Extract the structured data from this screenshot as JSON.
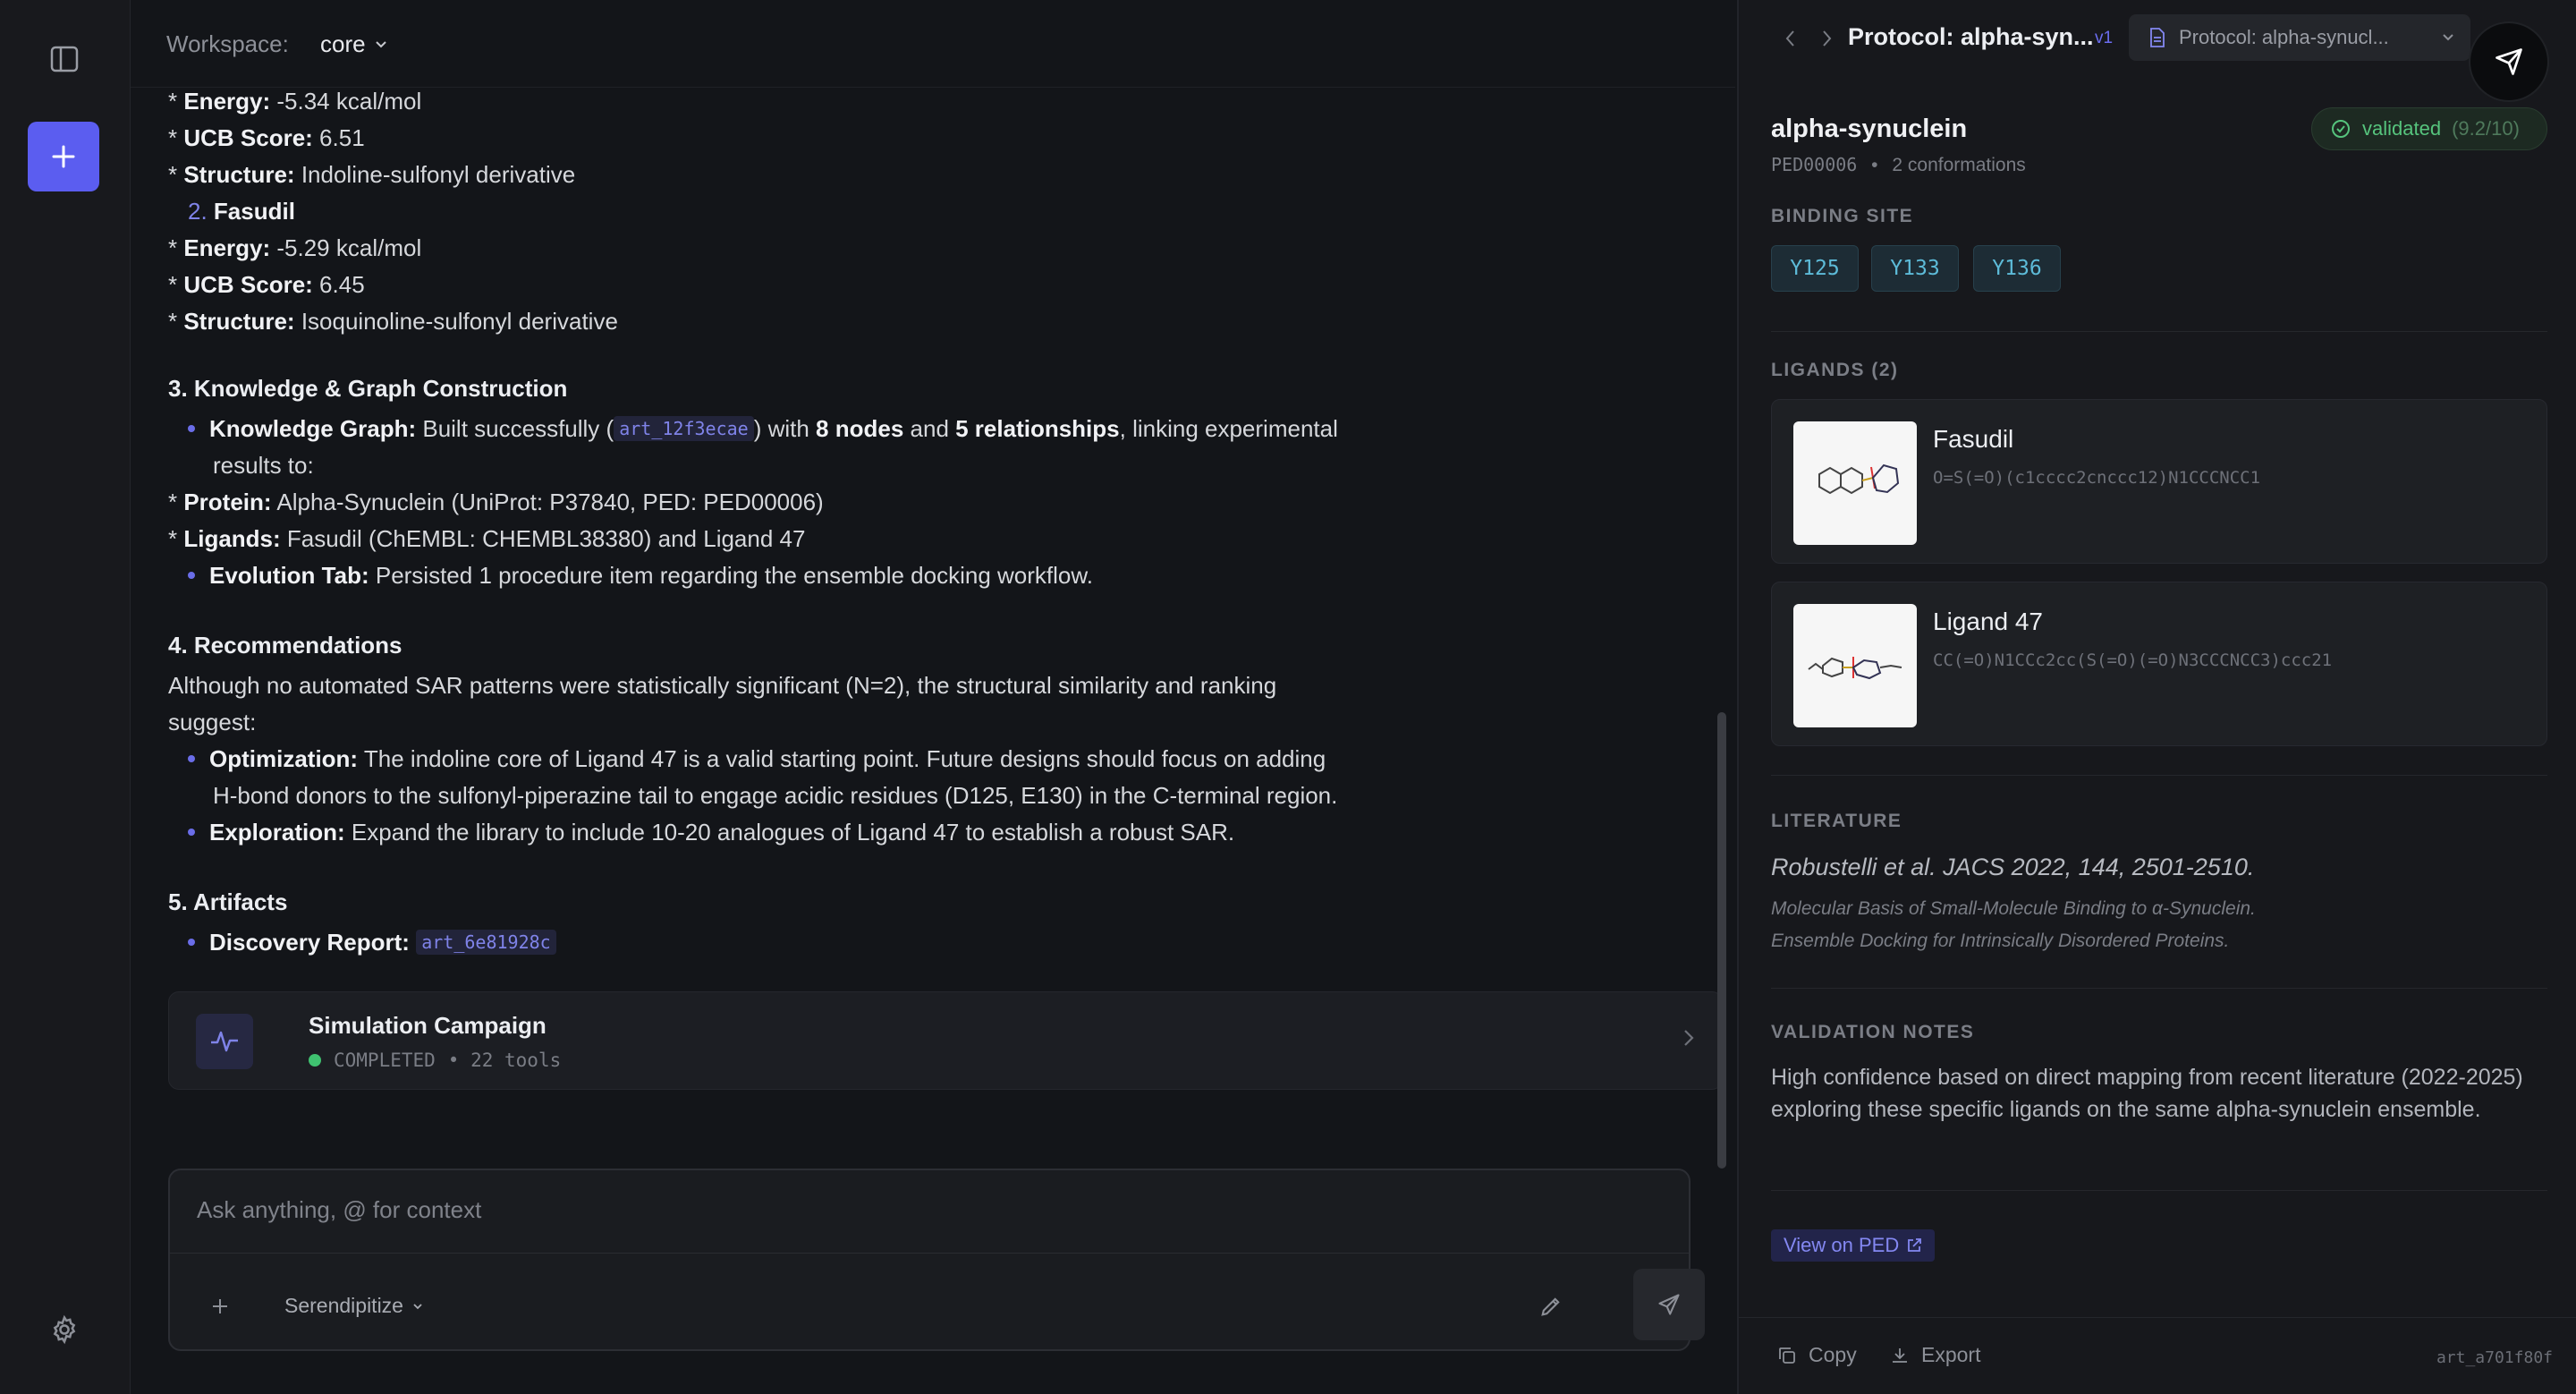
{
  "colors": {
    "accent": "#5b5df0",
    "success": "#3fc270",
    "link": "#8488f2",
    "residue": "#5dbbd8"
  },
  "rail": {
    "toggle_icon": "sidebar-toggle-icon",
    "new_icon": "plus-icon",
    "settings_icon": "gear-icon"
  },
  "workspace": {
    "label": "Workspace:",
    "value": "core"
  },
  "report": {
    "l1_label": "Energy:",
    "l1_value": " -5.34 kcal/mol",
    "l2_label": "UCB Score:",
    "l2_value": " 6.51",
    "l3_label": "Structure:",
    "l3_value": " Indoline-sulfonyl derivative",
    "l4_num": "2.",
    "l4_name": "Fasudil",
    "l5_label": "Energy:",
    "l5_value": " -5.29 kcal/mol",
    "l6_label": "UCB Score:",
    "l6_value": " 6.45",
    "l7_label": "Structure:",
    "l7_value": " Isoquinoline-sulfonyl derivative",
    "h3": "3. Knowledge & Graph Construction",
    "kg_label": "Knowledge Graph:",
    "kg_pre": " Built successfully (",
    "kg_chip": "art_12f3ecae",
    "kg_mid1": ") with ",
    "kg_nodes": "8 nodes",
    "kg_mid2": " and ",
    "kg_rels": "5 relationships",
    "kg_post": ", linking experimental",
    "kg_cont": "results to:",
    "prot_label": "Protein:",
    "prot_value": " Alpha-Synuclein (UniProt: P37840, PED: PED00006)",
    "lig_label": "Ligands:",
    "lig_value": " Fasudil (ChEMBL: CHEMBL38380) and Ligand 47",
    "evo_label": "Evolution Tab:",
    "evo_value": " Persisted 1 procedure item regarding the ensemble docking workflow.",
    "h4": "4. Recommendations",
    "rec_p1": "Although no automated SAR patterns were statistically significant (N=2), the structural similarity and ranking",
    "rec_p2": "suggest:",
    "opt_label": "Optimization:",
    "opt_value": " The indoline core of Ligand 47 is a valid starting point. Future designs should focus on adding",
    "opt_cont": "H-bond donors to the sulfonyl-piperazine tail to engage acidic residues (D125, E130) in the C-terminal region.",
    "exp_label": "Exploration:",
    "exp_value": " Expand the library to include 10-20 analogues of Ligand 47 to establish a robust SAR.",
    "h5": "5. Artifacts",
    "art_label": "Discovery Report:",
    "art_chip": "art_6e81928c"
  },
  "campaign": {
    "title": "Simulation Campaign",
    "status": "COMPLETED",
    "tools": "• 22 tools"
  },
  "composer": {
    "placeholder": "Ask anything, @ for context",
    "mode": "Serendipitize"
  },
  "panel": {
    "title": "Protocol: alpha-syn...",
    "version": "v1",
    "doc_selector": "Protocol: alpha-synucl...",
    "name": "alpha-synuclein",
    "ped_id": "PED00006",
    "sep": "•",
    "conformations": "2 conformations",
    "badge_label": "validated",
    "badge_score": "(9.2/10)",
    "binding_label": "BINDING SITE",
    "residues": [
      "Y125",
      "Y133",
      "Y136"
    ],
    "ligands_label": "LIGANDS (2)",
    "ligands": [
      {
        "name": "Fasudil",
        "smiles": "O=S(=O)(c1cccc2cnccc12)N1CCCNCC1"
      },
      {
        "name": "Ligand 47",
        "smiles": "CC(=O)N1CCc2cc(S(=O)(=O)N3CCCNCC3)ccc21"
      }
    ],
    "literature_label": "LITERATURE",
    "citation": "Robustelli et al. JACS 2022, 144, 2501-2510.",
    "lit_title1": "Molecular Basis of Small-Molecule Binding to α-Synuclein.",
    "lit_title2": "Ensemble Docking for Intrinsically Disordered Proteins.",
    "notes_label": "VALIDATION NOTES",
    "notes": "High confidence based on direct mapping from recent literature (2022-2025) exploring these specific ligands on the same alpha-synuclein ensemble.",
    "ped_link": "View on PED",
    "copy": "Copy",
    "export": "Export",
    "artifact_id": "art_a701f80f"
  }
}
